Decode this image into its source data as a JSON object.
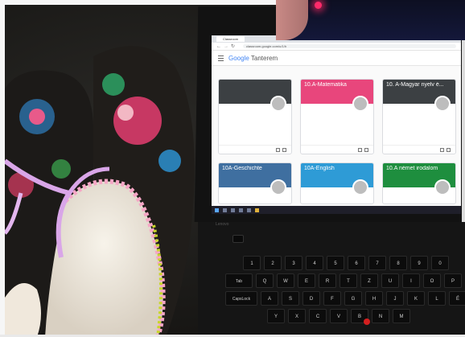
{
  "browser": {
    "tab_label": "Classroom",
    "url": "classroom.google.com/u/1/h"
  },
  "app": {
    "brand": "Google",
    "product": "Tanterem"
  },
  "classes": [
    {
      "title": "",
      "subtitle": "",
      "color": "#3c4043",
      "col": 0,
      "row": 0
    },
    {
      "title": "10.A-Matematika",
      "subtitle": "",
      "color": "#e8467c",
      "col": 1,
      "row": 0
    },
    {
      "title": "10. A-Magyar nyelv é...",
      "subtitle": "",
      "color": "#3c4043",
      "col": 2,
      "row": 0
    },
    {
      "title": "10A-Geschichte",
      "subtitle": "",
      "color": "#3f6fa0",
      "col": 0,
      "row": 1
    },
    {
      "title": "10A-English",
      "subtitle": "",
      "color": "#2e9bd6",
      "col": 1,
      "row": 1
    },
    {
      "title": "10.A német irodalom",
      "subtitle": "",
      "color": "#1e8e3e",
      "col": 2,
      "row": 1
    }
  ],
  "laptop": {
    "logo": "Lenovo"
  },
  "keyboard": {
    "row_numbers": [
      "1",
      "2",
      "3",
      "4",
      "5",
      "6",
      "7",
      "8",
      "9",
      "0"
    ],
    "row_top": [
      "Q",
      "W",
      "E",
      "R",
      "T",
      "Z",
      "U",
      "I",
      "O",
      "P"
    ],
    "row_home": [
      "A",
      "S",
      "D",
      "F",
      "G",
      "H",
      "J",
      "K",
      "L",
      "É"
    ],
    "row_bottom": [
      "Y",
      "X",
      "C",
      "V",
      "B",
      "N",
      "M"
    ],
    "tab_label": "Tab",
    "caps_label": "CapsLock",
    "accent_red": "#d41f1f"
  },
  "colors": {
    "inset_light": "#ff2a6a",
    "slipper_pink": "#f6a6c6",
    "slipper_fleece": "#f3ede2"
  }
}
